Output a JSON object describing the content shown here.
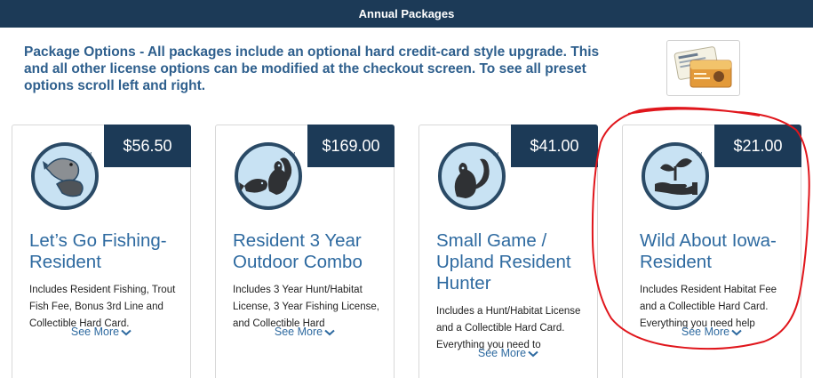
{
  "header": {
    "title": "Annual Packages"
  },
  "intro": {
    "text": "Package Options - All packages include an optional hard credit-card style upgrade. This and all other license options can be modified at the checkout screen. To see all preset options scroll left and right."
  },
  "colors": {
    "navy": "#1c3a57",
    "blue": "#2e6aa0",
    "annotation": "#e0161c"
  },
  "packages": [
    {
      "price": "$56.50",
      "title": "Let’s Go Fishing-Resident",
      "description": "Includes Resident Fishing, Trout Fish Fee, Bonus 3rd Line and Collectible Hard Card.",
      "see_more": "See More",
      "icon": "fish-icon"
    },
    {
      "price": "$169.00",
      "title": "Resident 3 Year Outdoor Combo",
      "description": "Includes 3 Year Hunt/Habitat License, 3 Year Fishing License, and Collectible Hard",
      "see_more": "See More",
      "icon": "squirrel-fish-icon"
    },
    {
      "price": "$41.00",
      "title": "Small Game / Upland Resident Hunter",
      "description": "Includes a Hunt/Habitat License and a Collectible Hard Card. Everything you need to",
      "see_more": "See More",
      "icon": "squirrel-icon"
    },
    {
      "price": "$21.00",
      "title": "Wild About Iowa-Resident",
      "description": "Includes Resident Habitat Fee and a Collectible Hard Card. Everything you need help",
      "see_more": "See More",
      "icon": "plant-hand-icon"
    }
  ]
}
